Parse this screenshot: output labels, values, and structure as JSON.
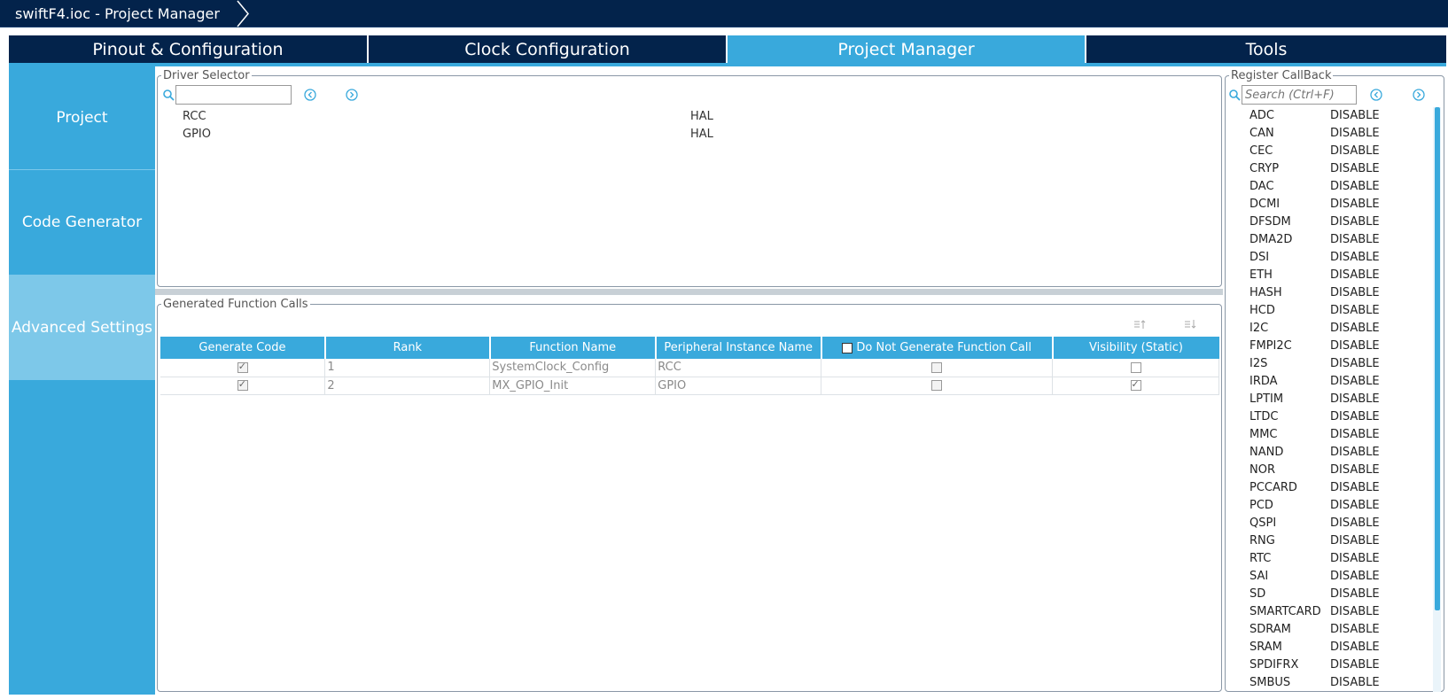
{
  "window": {
    "breadcrumb": "swiftF4.ioc - Project Manager"
  },
  "tabs": [
    {
      "label": "Pinout & Configuration"
    },
    {
      "label": "Clock Configuration"
    },
    {
      "label": "Project Manager"
    },
    {
      "label": "Tools"
    }
  ],
  "sidebar": {
    "items": [
      {
        "label": "Project"
      },
      {
        "label": "Code Generator"
      },
      {
        "label": "Advanced Settings"
      }
    ]
  },
  "driver_selector": {
    "title": "Driver Selector",
    "search_value": "",
    "rows": [
      {
        "name": "RCC",
        "driver": "HAL"
      },
      {
        "name": "GPIO",
        "driver": "HAL"
      }
    ]
  },
  "generated_calls": {
    "title": "Generated Function Calls",
    "columns": [
      "Generate Code",
      "Rank",
      "Function Name",
      "Peripheral Instance Name",
      "Do Not Generate Function Call",
      "Visibility (Static)"
    ],
    "rows": [
      {
        "generate": true,
        "rank": "1",
        "function": "SystemClock_Config",
        "instance": "RCC",
        "do_not_generate": false,
        "visibility": false
      },
      {
        "generate": true,
        "rank": "2",
        "function": "MX_GPIO_Init",
        "instance": "GPIO",
        "do_not_generate": false,
        "visibility": true
      }
    ]
  },
  "register_callback": {
    "title": "Register CallBack",
    "search_placeholder": "Search (Ctrl+F)",
    "rows": [
      {
        "name": "ADC",
        "value": "DISABLE"
      },
      {
        "name": "CAN",
        "value": "DISABLE"
      },
      {
        "name": "CEC",
        "value": "DISABLE"
      },
      {
        "name": "CRYP",
        "value": "DISABLE"
      },
      {
        "name": "DAC",
        "value": "DISABLE"
      },
      {
        "name": "DCMI",
        "value": "DISABLE"
      },
      {
        "name": "DFSDM",
        "value": "DISABLE"
      },
      {
        "name": "DMA2D",
        "value": "DISABLE"
      },
      {
        "name": "DSI",
        "value": "DISABLE"
      },
      {
        "name": "ETH",
        "value": "DISABLE"
      },
      {
        "name": "HASH",
        "value": "DISABLE"
      },
      {
        "name": "HCD",
        "value": "DISABLE"
      },
      {
        "name": "I2C",
        "value": "DISABLE"
      },
      {
        "name": "FMPI2C",
        "value": "DISABLE"
      },
      {
        "name": "I2S",
        "value": "DISABLE"
      },
      {
        "name": "IRDA",
        "value": "DISABLE"
      },
      {
        "name": "LPTIM",
        "value": "DISABLE"
      },
      {
        "name": "LTDC",
        "value": "DISABLE"
      },
      {
        "name": "MMC",
        "value": "DISABLE"
      },
      {
        "name": "NAND",
        "value": "DISABLE"
      },
      {
        "name": "NOR",
        "value": "DISABLE"
      },
      {
        "name": "PCCARD",
        "value": "DISABLE"
      },
      {
        "name": "PCD",
        "value": "DISABLE"
      },
      {
        "name": "QSPI",
        "value": "DISABLE"
      },
      {
        "name": "RNG",
        "value": "DISABLE"
      },
      {
        "name": "RTC",
        "value": "DISABLE"
      },
      {
        "name": "SAI",
        "value": "DISABLE"
      },
      {
        "name": "SD",
        "value": "DISABLE"
      },
      {
        "name": "SMARTCARD",
        "value": "DISABLE"
      },
      {
        "name": "SDRAM",
        "value": "DISABLE"
      },
      {
        "name": "SRAM",
        "value": "DISABLE"
      },
      {
        "name": "SPDIFRX",
        "value": "DISABLE"
      },
      {
        "name": "SMBUS",
        "value": "DISABLE"
      }
    ]
  },
  "colors": {
    "navy": "#03234b",
    "accent": "#39a9dc",
    "active_side": "#7dc8e9"
  }
}
